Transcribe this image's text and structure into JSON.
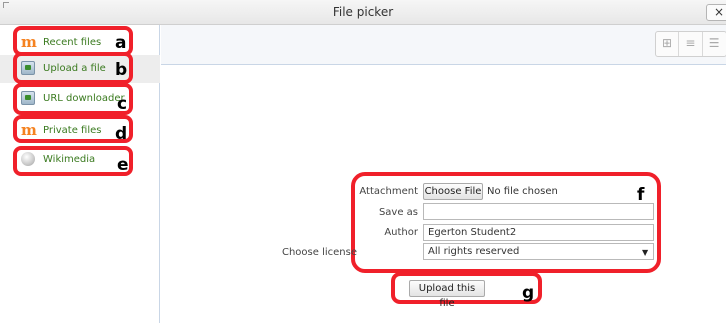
{
  "window": {
    "title": "File picker",
    "close_glyph": "×"
  },
  "repositories": [
    {
      "label": "Recent files",
      "icon": "moodle-icon",
      "marker": "a",
      "active": false
    },
    {
      "label": "Upload a file",
      "icon": "upload-icon",
      "marker": "b",
      "active": true
    },
    {
      "label": "URL downloader",
      "icon": "upload-icon",
      "marker": "c",
      "active": false
    },
    {
      "label": "Private files",
      "icon": "moodle-icon",
      "marker": "d",
      "active": false
    },
    {
      "label": "Wikimedia",
      "icon": "globe-icon",
      "marker": "e",
      "active": false
    }
  ],
  "toolbar": {
    "view_buttons": [
      {
        "name": "icon-view-button",
        "glyph": "⊞"
      },
      {
        "name": "list-view-button",
        "glyph": "≡"
      },
      {
        "name": "tree-view-button",
        "glyph": "☰"
      }
    ]
  },
  "form": {
    "attachment_label": "Attachment",
    "choose_file_label": "Choose File",
    "no_file_text": "No file chosen",
    "save_as_label": "Save as",
    "save_as_value": "",
    "author_label": "Author",
    "author_value": "Egerton Student2",
    "license_label": "Choose license",
    "license_value": "All rights reserved",
    "upload_button_label": "Upload this file",
    "marker_form": "f",
    "marker_upload": "g"
  },
  "colors": {
    "annotation": "#f0202a",
    "link": "#3a7a1f",
    "moodle_orange": "#f58220"
  }
}
